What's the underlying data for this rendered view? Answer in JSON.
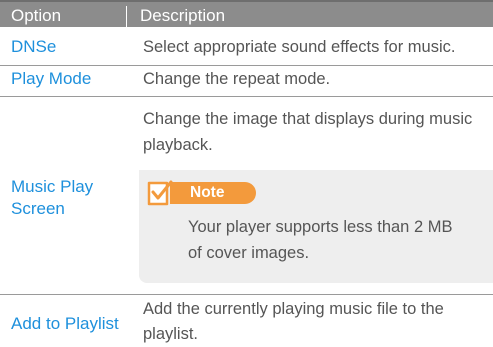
{
  "header": {
    "option_label": "Option",
    "description_label": "Description"
  },
  "rows": [
    {
      "option": "DNSe",
      "description": "Select appropriate sound effects for music."
    },
    {
      "option": "Play Mode",
      "description": "Change the repeat mode."
    },
    {
      "option_line1": "Music Play",
      "option_line2": "Screen",
      "description_line1": "Change the image that displays during music",
      "description_line2": "playback.",
      "note": {
        "label": "Note",
        "line1": "Your player supports less than 2 MB",
        "line2": "of cover images.",
        "icon": "note-check-icon"
      }
    },
    {
      "option": "Add to Playlist",
      "description_line1": "Add the currently playing music file to the",
      "description_line2": "playlist."
    }
  ],
  "colors": {
    "header_bg": "#8c8c8c",
    "option_text": "#1e90dc",
    "note_accent": "#f39a3c",
    "note_bg": "#eeeeee"
  }
}
